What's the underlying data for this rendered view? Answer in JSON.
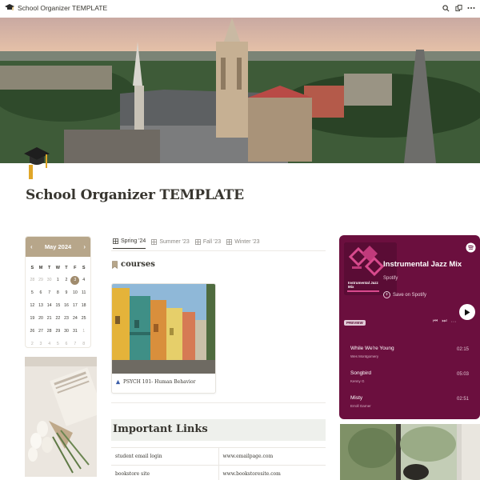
{
  "window": {
    "title": "School Organizer TEMPLATE"
  },
  "page": {
    "title": "School Organizer TEMPLATE"
  },
  "calendar": {
    "month_label": "May 2024",
    "weekdays": [
      "S",
      "M",
      "T",
      "W",
      "T",
      "F",
      "S"
    ],
    "days": [
      [
        "28",
        "29",
        "30",
        "1",
        "2",
        "3",
        "4"
      ],
      [
        "5",
        "6",
        "7",
        "8",
        "9",
        "10",
        "11"
      ],
      [
        "12",
        "13",
        "14",
        "15",
        "16",
        "17",
        "18"
      ],
      [
        "19",
        "20",
        "21",
        "22",
        "23",
        "24",
        "25"
      ],
      [
        "26",
        "27",
        "28",
        "29",
        "30",
        "31",
        "1"
      ],
      [
        "2",
        "3",
        "4",
        "5",
        "6",
        "7",
        "8"
      ]
    ],
    "today": "3"
  },
  "tabs": [
    {
      "label": "Spring '24",
      "active": true
    },
    {
      "label": "Summer '23",
      "active": false
    },
    {
      "label": "Fall '23",
      "active": false
    },
    {
      "label": "Winter '23",
      "active": false
    }
  ],
  "courses": {
    "heading": "courses",
    "card_label": "PSYCH 101- Human Behavior"
  },
  "links": {
    "heading": "Important Links",
    "rows": [
      [
        "student email login",
        "www.emailpage.com"
      ],
      [
        "bookstore site",
        "www.bookstoresite.com"
      ]
    ]
  },
  "spotify": {
    "playlist": "Instrumental Jazz Mix",
    "source": "Spotify",
    "save_label": "Save on Spotify",
    "preview_label": "PREVIEW",
    "art_text_1": "Instrumental Jazz",
    "art_text_2": "Mix",
    "tracks": [
      {
        "name": "While We're Young",
        "artist": "Wes Montgomery",
        "duration": "02:15"
      },
      {
        "name": "Songbird",
        "artist": "Kenny G",
        "duration": "05:03"
      },
      {
        "name": "Misty",
        "artist": "Erroll Garner",
        "duration": "02:51"
      }
    ],
    "colors": {
      "background": "#6b0f3e",
      "accent": "#c13a7b"
    }
  },
  "icons": {
    "page_icon": "graduation-cap-icon",
    "search": "search-icon",
    "duplicate": "duplicate-icon",
    "more": "more-icon"
  }
}
